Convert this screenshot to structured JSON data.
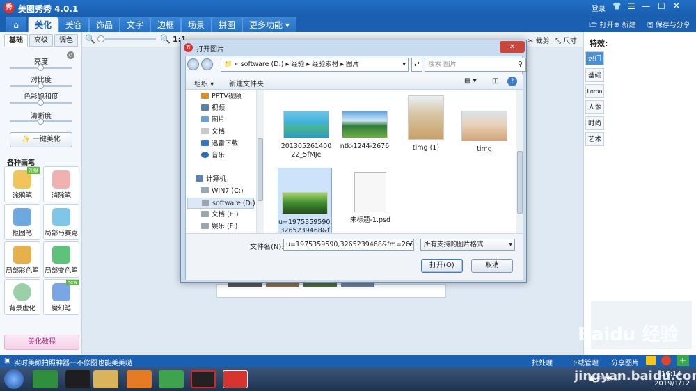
{
  "app": {
    "title": "美图秀秀 4.0.1",
    "login": "登录"
  },
  "menu": {
    "tabs": [
      "美化",
      "美容",
      "饰品",
      "文字",
      "边框",
      "场景",
      "拼图",
      "更多功能"
    ],
    "active": "美化",
    "right": {
      "open": "打开",
      "new": "新建",
      "save": "保存与分享"
    }
  },
  "left": {
    "tabs": [
      "基础",
      "高级",
      "调色"
    ],
    "sliders": [
      "亮度",
      "对比度",
      "色彩饱和度",
      "清晰度"
    ],
    "one_key": "一键美化",
    "section": "各种画笔",
    "tools": [
      "涂鸦笔",
      "消除笔",
      "抠图笔",
      "局部马赛克",
      "局部彩色笔",
      "局部变色笔",
      "背景虚化",
      "魔幻笔"
    ],
    "badges": {
      "tool0": "升级",
      "tool7": "new"
    },
    "tutorial": "美化教程"
  },
  "workbar": {
    "zoom_label": "1:1",
    "crop": "裁剪",
    "size": "尺寸"
  },
  "right": {
    "title": "特效:",
    "tabs": [
      "热门",
      "基础",
      "Lomo",
      "人像",
      "时尚",
      "艺术"
    ],
    "active": "热门"
  },
  "dialog": {
    "title": "打开图片",
    "breadcrumb": [
      "software (D:)",
      "经验",
      "经验素材",
      "图片"
    ],
    "search_placeholder": "搜索 图片",
    "organize": "组织",
    "new_folder": "新建文件夹",
    "nav": [
      "PPTV视频",
      "视频",
      "图片",
      "文档",
      "迅雷下载",
      "音乐",
      "计算机",
      "WIN7 (C:)",
      "software (D:)",
      "文档 (E:)",
      "娱乐 (F:)"
    ],
    "files": [
      {
        "name": "201305261400 22_5fMJe",
        "thumb": "island"
      },
      {
        "name": "ntk-1244-2676",
        "thumb": "landscape"
      },
      {
        "name": "timg (1)",
        "thumb": "girl1"
      },
      {
        "name": "timg",
        "thumb": "girl2"
      },
      {
        "name": "u=1975359590, 3265239468&f m=26&gp=0",
        "thumb": "forest"
      },
      {
        "name": "未标题-1.psd",
        "thumb": "blank"
      }
    ],
    "filename_label": "文件名(N):",
    "filename_value": "u=1975359590,3265239468&fm=26&gp",
    "filetype": "所有支持的图片格式",
    "open": "打开(O)",
    "cancel": "取消"
  },
  "status": {
    "text": "实时美颜拍照神器一不修图也能美美哒",
    "right": [
      "批处理",
      "下载管理",
      "分享图片"
    ]
  },
  "taskbar": {
    "time": "16:14",
    "date": "2019/1/12"
  },
  "watermark": {
    "line1": "Baidu 经验",
    "line2": "jingyan.baidu.com"
  },
  "colors": {
    "brand": "#1a5fb0",
    "accent": "#4a90d9"
  }
}
